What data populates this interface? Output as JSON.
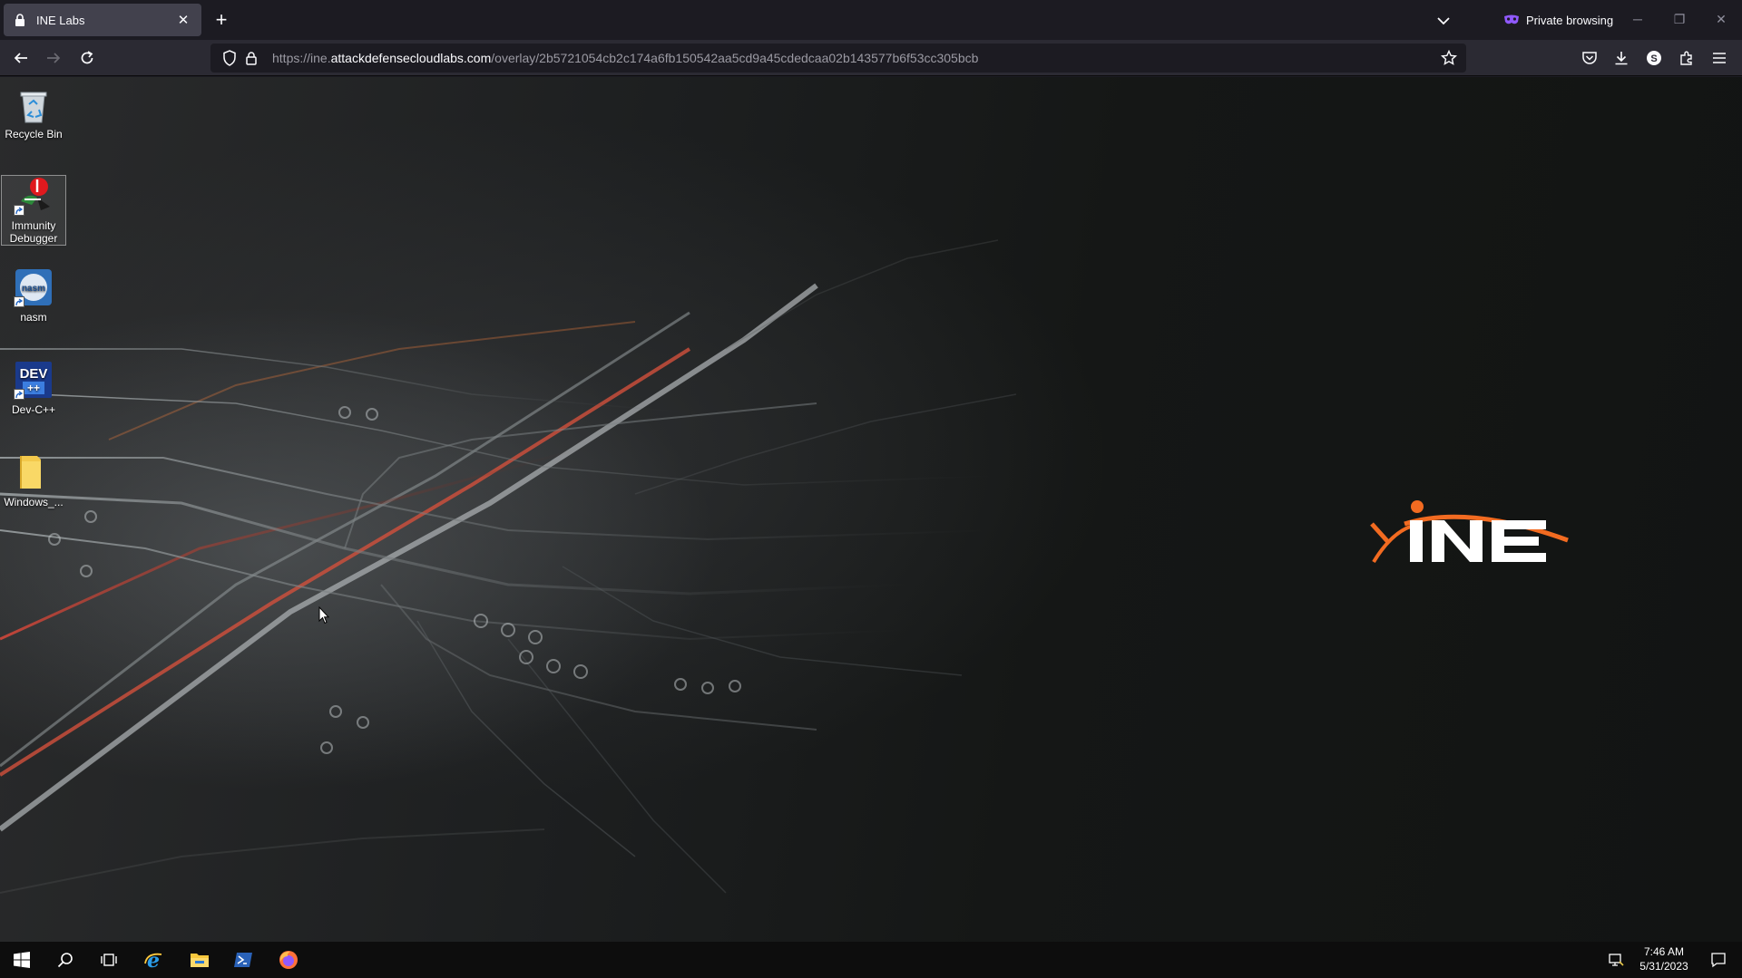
{
  "browser": {
    "tab_title": "INE Labs",
    "new_tab_label": "+",
    "private_label": "Private browsing",
    "url_prefix": "https://ine.",
    "url_domain": "attackdefensecloudlabs.com",
    "url_path": "/overlay/2b5721054cb2c174a6fb150542aa5cd9a45cdedcaa02b143577b6f53cc305bcb",
    "accent_color": "#9059ff"
  },
  "desktop": {
    "icons": [
      {
        "label": "Recycle Bin",
        "icon": "recycle-bin-icon"
      },
      {
        "label": "Immunity Debugger",
        "icon": "immunity-debugger-icon"
      },
      {
        "label": "nasm",
        "icon": "nasm-icon"
      },
      {
        "label": "Dev-C++",
        "icon": "dev-cpp-icon"
      },
      {
        "label": "Windows_...",
        "icon": "folder-icon"
      }
    ],
    "logo_text": "INE",
    "logo_color": "#f26b21"
  },
  "taskbar": {
    "pinned": [
      "windows-start-icon",
      "search-icon",
      "task-view-icon",
      "internet-explorer-icon",
      "file-explorer-icon",
      "powershell-icon",
      "firefox-icon"
    ],
    "time": "7:46 AM",
    "date": "5/31/2023"
  }
}
